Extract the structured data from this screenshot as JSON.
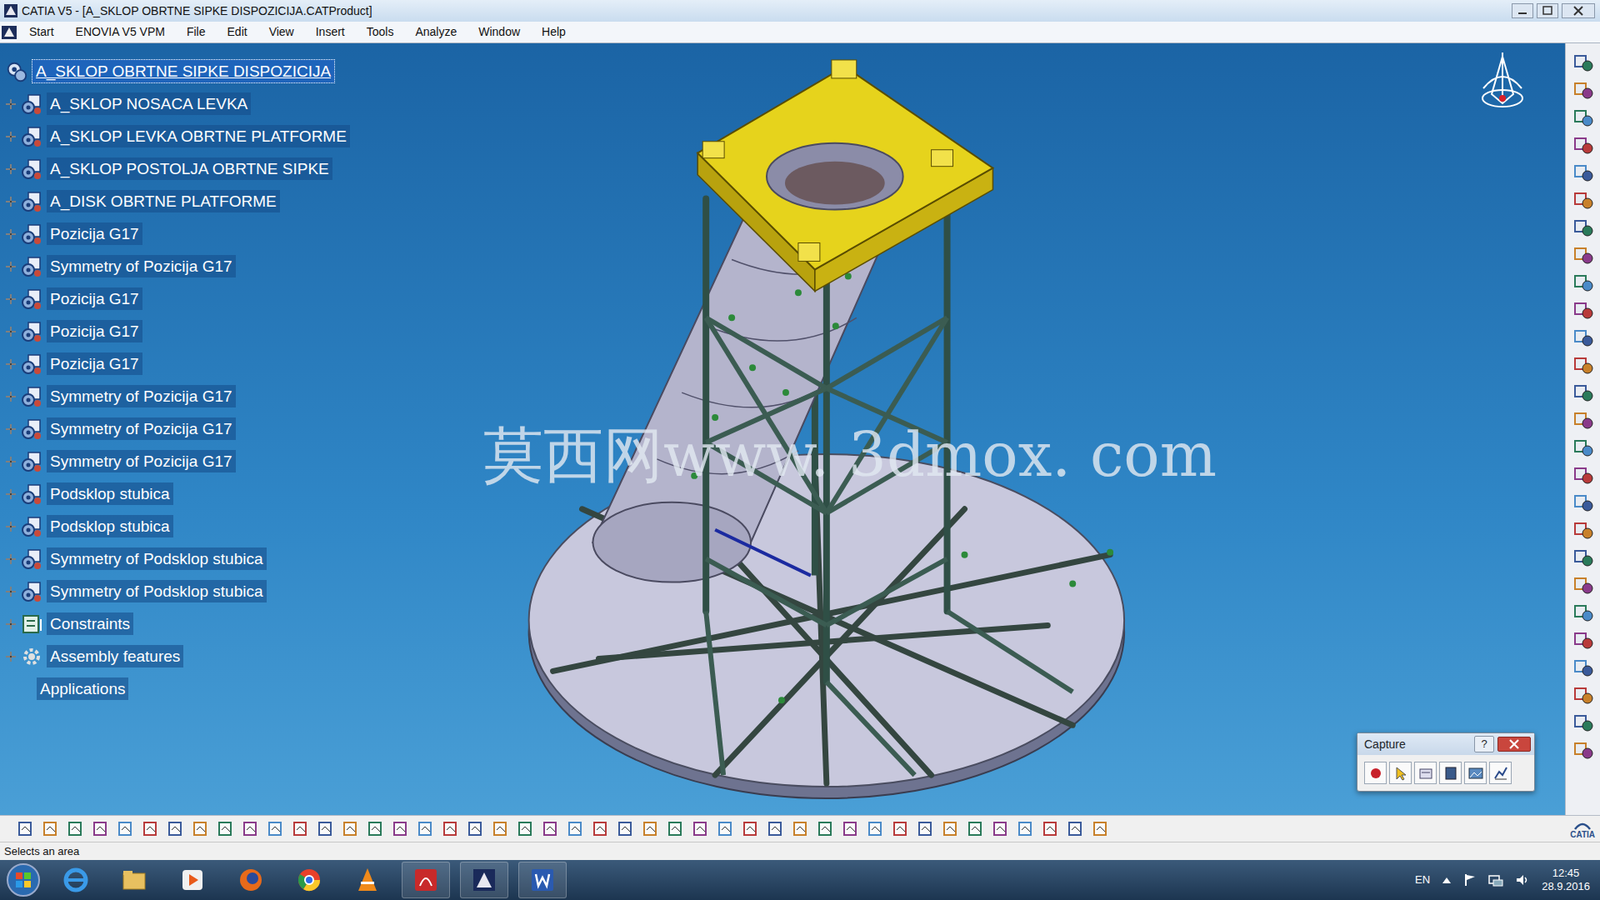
{
  "window": {
    "title": "CATIA V5 - [A_SKLOP OBRTNE SIPKE DISPOZICIJA.CATProduct]"
  },
  "menu": [
    "Start",
    "ENOVIA V5 VPM",
    "File",
    "Edit",
    "View",
    "Insert",
    "Tools",
    "Analyze",
    "Window",
    "Help"
  ],
  "tree": {
    "root": {
      "label": "A_SKLOP OBRTNE SIPKE DISPOZICIJA",
      "selected": true
    },
    "items": [
      {
        "label": "A_SKLOP NOSACA LEVKA",
        "kind": "product",
        "expanded": false
      },
      {
        "label": "A_SKLOP LEVKA OBRTNE PLATFORME",
        "kind": "product",
        "expanded": false
      },
      {
        "label": "A_SKLOP POSTOLJA OBRTNE SIPKE",
        "kind": "product",
        "expanded": false
      },
      {
        "label": "A_DISK OBRTNE PLATFORME",
        "kind": "product",
        "expanded": false
      },
      {
        "label": "Pozicija G17",
        "kind": "product",
        "expanded": false
      },
      {
        "label": "Symmetry of Pozicija G17",
        "kind": "product",
        "expanded": false
      },
      {
        "label": "Pozicija G17",
        "kind": "product",
        "expanded": false
      },
      {
        "label": "Pozicija G17",
        "kind": "product",
        "expanded": false
      },
      {
        "label": "Pozicija G17",
        "kind": "product",
        "expanded": false
      },
      {
        "label": "Symmetry of Pozicija G17",
        "kind": "product",
        "expanded": false
      },
      {
        "label": "Symmetry of Pozicija G17",
        "kind": "product",
        "expanded": false
      },
      {
        "label": "Symmetry of Pozicija G17",
        "kind": "product",
        "expanded": false
      },
      {
        "label": "Podsklop stubica",
        "kind": "product",
        "expanded": false
      },
      {
        "label": "Podsklop stubica",
        "kind": "product",
        "expanded": false
      },
      {
        "label": "Symmetry of Podsklop stubica",
        "kind": "product",
        "expanded": false
      },
      {
        "label": "Symmetry of Podsklop stubica",
        "kind": "product",
        "expanded": false
      },
      {
        "label": "Constraints",
        "kind": "constraints",
        "expanded": false
      },
      {
        "label": "Assembly features",
        "kind": "features",
        "expanded": false
      },
      {
        "label": "Applications",
        "kind": "applications"
      }
    ]
  },
  "watermark": "莫西网www. 3dmox. com",
  "capture": {
    "title": "Capture",
    "help": "?"
  },
  "logo": "CATIA",
  "status_bar": "Selects an area",
  "taskbar": {
    "language": "EN",
    "time": "12:45",
    "date": "28.9.2016"
  }
}
